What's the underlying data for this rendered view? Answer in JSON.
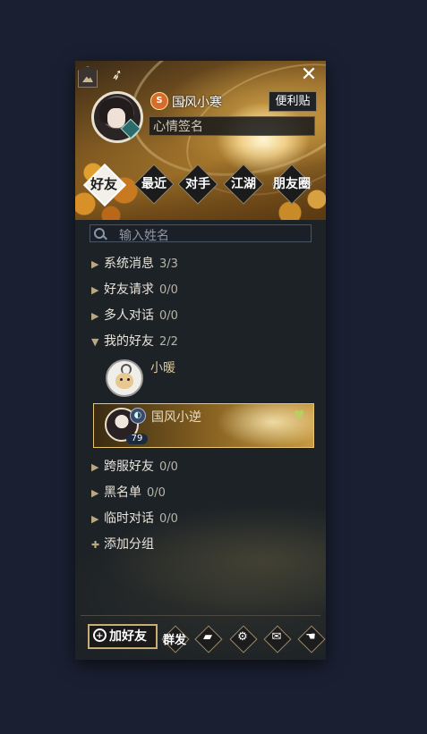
{
  "header": {
    "player_name": "国风小寒",
    "rank_glyph": "S",
    "notes_label": "便利贴",
    "mood_placeholder": "心情签名",
    "close_glyph": "✕",
    "bird_glyph": "➶"
  },
  "tabs": [
    {
      "label": "好友",
      "active": true
    },
    {
      "label": "最近",
      "active": false
    },
    {
      "label": "对手",
      "active": false
    },
    {
      "label": "江湖",
      "active": false
    },
    {
      "label": "朋友圈",
      "active": false
    }
  ],
  "search": {
    "placeholder": "输入姓名"
  },
  "groups": {
    "system": {
      "label": "系统消息",
      "count": "3/3"
    },
    "requests": {
      "label": "好友请求",
      "count": "0/0"
    },
    "multi": {
      "label": "多人对话",
      "count": "0/0"
    },
    "mine": {
      "label": "我的好友",
      "count": "2/2"
    },
    "cross": {
      "label": "跨服好友",
      "count": "0/0"
    },
    "blacklist": {
      "label": "黑名单",
      "count": "0/0"
    },
    "temp": {
      "label": "临时对话",
      "count": "0/0"
    },
    "add": {
      "label": "添加分组",
      "glyph": "✚"
    }
  },
  "friends": [
    {
      "name": "小暖",
      "selected": false
    },
    {
      "name": "国风小逆",
      "level": "79",
      "selected": true
    }
  ],
  "toolbar": {
    "add_friend": "加好友",
    "broadcast": "群发",
    "chat_glyph": "▰",
    "settings_glyph": "⚙",
    "mail_glyph": "✉",
    "hand_glyph": "☚"
  },
  "colors": {
    "accent_gold": "#c8ad74",
    "panel_bg": "#1d2226",
    "page_bg": "#1a2032"
  }
}
